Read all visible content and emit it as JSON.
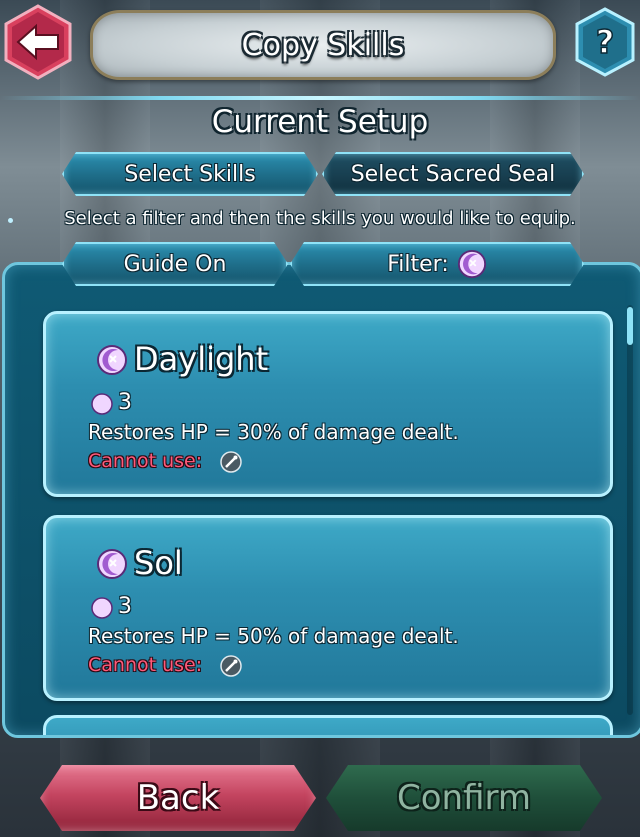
{
  "header": {
    "title": "Copy Skills",
    "back_icon": "back-arrow-icon",
    "help_icon": "help-question-icon",
    "help_label": "?"
  },
  "setup": {
    "heading": "Current Setup",
    "tabs": [
      {
        "label": "Select Skills"
      },
      {
        "label": "Select Sacred Seal"
      }
    ],
    "instruction": "Select a filter and then the skills you would like to equip."
  },
  "controls": {
    "guide_label": "Guide On",
    "filter_label": "Filter:",
    "filter_icon": "special-skill-icon"
  },
  "skills": [
    {
      "name": "Daylight",
      "icon": "special-skill-icon",
      "sp": "3",
      "description": "Restores HP = 30% of damage dealt.",
      "cannot_use_label": "Cannot use:",
      "cannot_use_icon": "staff-weapon-icon"
    },
    {
      "name": "Sol",
      "icon": "special-skill-icon",
      "sp": "3",
      "description": "Restores HP = 50% of damage dealt.",
      "cannot_use_label": "Cannot use:",
      "cannot_use_icon": "staff-weapon-icon"
    }
  ],
  "footer": {
    "back_label": "Back",
    "confirm_label": "Confirm"
  },
  "colors": {
    "accent": "#8fe3f7",
    "cannot_use": "#ff5a7a",
    "back_button": "#c44560",
    "confirm_button": "#1f4f3a"
  }
}
